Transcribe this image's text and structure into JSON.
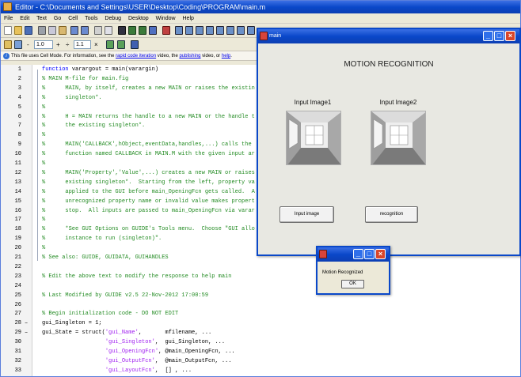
{
  "editor": {
    "title": "Editor - C:\\Documents and Settings\\USER\\Desktop\\Coding\\PROGRAM\\main.m",
    "menu": [
      "File",
      "Edit",
      "Text",
      "Go",
      "Cell",
      "Tools",
      "Debug",
      "Desktop",
      "Window",
      "Help"
    ],
    "cell_toolbar": {
      "value1": "1.0",
      "minus": "-",
      "plus": "+",
      "divide": "÷",
      "value2": "1.1",
      "times": "×"
    },
    "info": {
      "prefix": "This file uses Cell Mode. For information, see the ",
      "link1": "rapid code iteration",
      "mid1": " video, the ",
      "link2": "publishing",
      "mid2": " video, or ",
      "link3": "help",
      "suffix": "."
    }
  },
  "code": {
    "lines": [
      {
        "n": "1",
        "m": "",
        "segs": [
          {
            "c": "kw",
            "t": "function "
          },
          {
            "c": "tx",
            "t": "varargout = main(varargin)"
          }
        ]
      },
      {
        "n": "2",
        "m": "",
        "segs": [
          {
            "c": "cm",
            "t": "% MAIN M-file for main.fig"
          }
        ]
      },
      {
        "n": "3",
        "m": "",
        "segs": [
          {
            "c": "cm",
            "t": "%      MAIN, by itself, creates a new MAIN or raises the existin"
          }
        ]
      },
      {
        "n": "4",
        "m": "",
        "segs": [
          {
            "c": "cm",
            "t": "%      singleton*."
          }
        ]
      },
      {
        "n": "5",
        "m": "",
        "segs": [
          {
            "c": "cm",
            "t": "%"
          }
        ]
      },
      {
        "n": "6",
        "m": "",
        "segs": [
          {
            "c": "cm",
            "t": "%      H = MAIN returns the handle to a new MAIN or the handle t"
          }
        ]
      },
      {
        "n": "7",
        "m": "",
        "segs": [
          {
            "c": "cm",
            "t": "%      the existing singleton*."
          }
        ]
      },
      {
        "n": "8",
        "m": "",
        "segs": [
          {
            "c": "cm",
            "t": "%"
          }
        ]
      },
      {
        "n": "9",
        "m": "",
        "segs": [
          {
            "c": "cm",
            "t": "%      MAIN('CALLBACK',hObject,eventData,handles,...) calls the"
          }
        ]
      },
      {
        "n": "10",
        "m": "",
        "segs": [
          {
            "c": "cm",
            "t": "%      function named CALLBACK in MAIN.M with the given input ar"
          }
        ]
      },
      {
        "n": "11",
        "m": "",
        "segs": [
          {
            "c": "cm",
            "t": "%"
          }
        ]
      },
      {
        "n": "12",
        "m": "",
        "segs": [
          {
            "c": "cm",
            "t": "%      MAIN('Property','Value',...) creates a new MAIN or raises"
          }
        ]
      },
      {
        "n": "13",
        "m": "",
        "segs": [
          {
            "c": "cm",
            "t": "%      existing singleton*.  Starting from the left, property va"
          }
        ]
      },
      {
        "n": "14",
        "m": "",
        "segs": [
          {
            "c": "cm",
            "t": "%      applied to the GUI before main_OpeningFcn gets called.  A"
          }
        ]
      },
      {
        "n": "15",
        "m": "",
        "segs": [
          {
            "c": "cm",
            "t": "%      unrecognized property name or invalid value makes propert"
          }
        ]
      },
      {
        "n": "16",
        "m": "",
        "segs": [
          {
            "c": "cm",
            "t": "%      stop.  All inputs are passed to main_OpeningFcn via varar"
          }
        ]
      },
      {
        "n": "17",
        "m": "",
        "segs": [
          {
            "c": "cm",
            "t": "%"
          }
        ]
      },
      {
        "n": "18",
        "m": "",
        "segs": [
          {
            "c": "cm",
            "t": "%      *See GUI Options on GUIDE's Tools menu.  Choose \"GUI allo"
          }
        ]
      },
      {
        "n": "19",
        "m": "",
        "segs": [
          {
            "c": "cm",
            "t": "%      instance to run (singleton)\"."
          }
        ]
      },
      {
        "n": "20",
        "m": "",
        "segs": [
          {
            "c": "cm",
            "t": "%"
          }
        ]
      },
      {
        "n": "21",
        "m": "",
        "segs": [
          {
            "c": "cm",
            "t": "% See also: GUIDE, GUIDATA, GUIHANDLES"
          }
        ]
      },
      {
        "n": "22",
        "m": "",
        "segs": []
      },
      {
        "n": "23",
        "m": "",
        "segs": [
          {
            "c": "cm",
            "t": "% Edit the above text to modify the response to help main"
          }
        ]
      },
      {
        "n": "24",
        "m": "",
        "segs": []
      },
      {
        "n": "25",
        "m": "",
        "segs": [
          {
            "c": "cm",
            "t": "% Last Modified by GUIDE v2.5 22-Nov-2012 17:00:59"
          }
        ]
      },
      {
        "n": "26",
        "m": "",
        "segs": []
      },
      {
        "n": "27",
        "m": "",
        "segs": [
          {
            "c": "cm",
            "t": "% Begin initialization code - DO NOT EDIT"
          }
        ]
      },
      {
        "n": "28",
        "m": "–",
        "segs": [
          {
            "c": "tx",
            "t": "gui_Singleton = 1;"
          }
        ]
      },
      {
        "n": "29",
        "m": "–",
        "segs": [
          {
            "c": "tx",
            "t": "gui_State = struct("
          },
          {
            "c": "st",
            "t": "'gui_Name'"
          },
          {
            "c": "tx",
            "t": ",       mfilename, ..."
          }
        ]
      },
      {
        "n": "30",
        "m": "",
        "segs": [
          {
            "c": "tx",
            "t": "                   "
          },
          {
            "c": "st",
            "t": "'gui_Singleton'"
          },
          {
            "c": "tx",
            "t": ",  gui_Singleton, ..."
          }
        ]
      },
      {
        "n": "31",
        "m": "",
        "segs": [
          {
            "c": "tx",
            "t": "                   "
          },
          {
            "c": "st",
            "t": "'gui_OpeningFcn'"
          },
          {
            "c": "tx",
            "t": ", @main_OpeningFcn, ..."
          }
        ]
      },
      {
        "n": "32",
        "m": "",
        "segs": [
          {
            "c": "tx",
            "t": "                   "
          },
          {
            "c": "st",
            "t": "'gui_OutputFcn'"
          },
          {
            "c": "tx",
            "t": ",  @main_OutputFcn, ..."
          }
        ]
      },
      {
        "n": "33",
        "m": "",
        "segs": [
          {
            "c": "tx",
            "t": "                   "
          },
          {
            "c": "st",
            "t": "'gui_LayoutFcn'"
          },
          {
            "c": "tx",
            "t": ",  [] , ..."
          }
        ]
      }
    ]
  },
  "gui": {
    "window_title": "main",
    "heading": "MOTION RECOGNITION",
    "label1": "Input Image1",
    "label2": "Input Image2",
    "input_button": "Input image",
    "recognition_button": "recognition"
  },
  "msgbox": {
    "message": "Motion Recognized",
    "ok": "OK"
  },
  "colors": {
    "keyword": "#0000ff",
    "comment": "#228b22",
    "string": "#a020f0",
    "titlebar": "#0a48c9"
  }
}
